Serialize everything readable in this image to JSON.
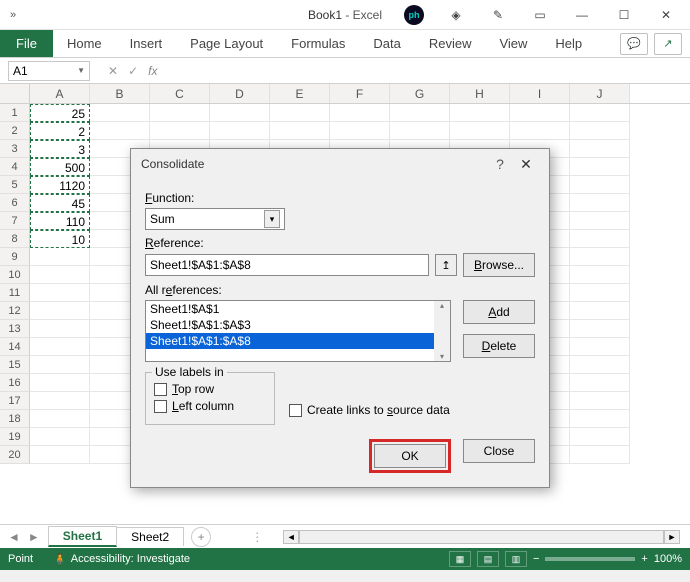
{
  "titlebar": {
    "title_doc": "Book1",
    "title_app": " - Excel"
  },
  "ribbon": {
    "file": "File",
    "tabs": [
      "Home",
      "Insert",
      "Page Layout",
      "Formulas",
      "Data",
      "Review",
      "View",
      "Help"
    ]
  },
  "namebox": "A1",
  "columns": [
    "A",
    "B",
    "C",
    "D",
    "E",
    "F",
    "G",
    "H",
    "I",
    "J"
  ],
  "rownums": [
    "1",
    "2",
    "3",
    "4",
    "5",
    "6",
    "7",
    "8",
    "9",
    "10",
    "11",
    "12",
    "13",
    "14",
    "15",
    "16",
    "17",
    "18",
    "19",
    "20"
  ],
  "cells_colA": [
    "25",
    "2",
    "3",
    "500",
    "1120",
    "45",
    "110",
    "10"
  ],
  "sheets": {
    "active": "Sheet1",
    "other": "Sheet2"
  },
  "status": {
    "mode": "Point",
    "accessibility": "Accessibility: Investigate",
    "zoom": "100%"
  },
  "dialog": {
    "title": "Consolidate",
    "function_label": "Function:",
    "function_value": "Sum",
    "reference_label": "Reference:",
    "reference_value": "Sheet1!$A$1:$A$8",
    "browse": "Browse...",
    "allrefs_label": "All references:",
    "list": [
      "Sheet1!$A$1",
      "Sheet1!$A$1:$A$3",
      "Sheet1!$A$1:$A$8"
    ],
    "add": "Add",
    "delete": "Delete",
    "uselabels": "Use labels in",
    "toprow": "Top row",
    "leftcol": "Left column",
    "createlinks": "Create links to source data",
    "ok": "OK",
    "close": "Close"
  }
}
